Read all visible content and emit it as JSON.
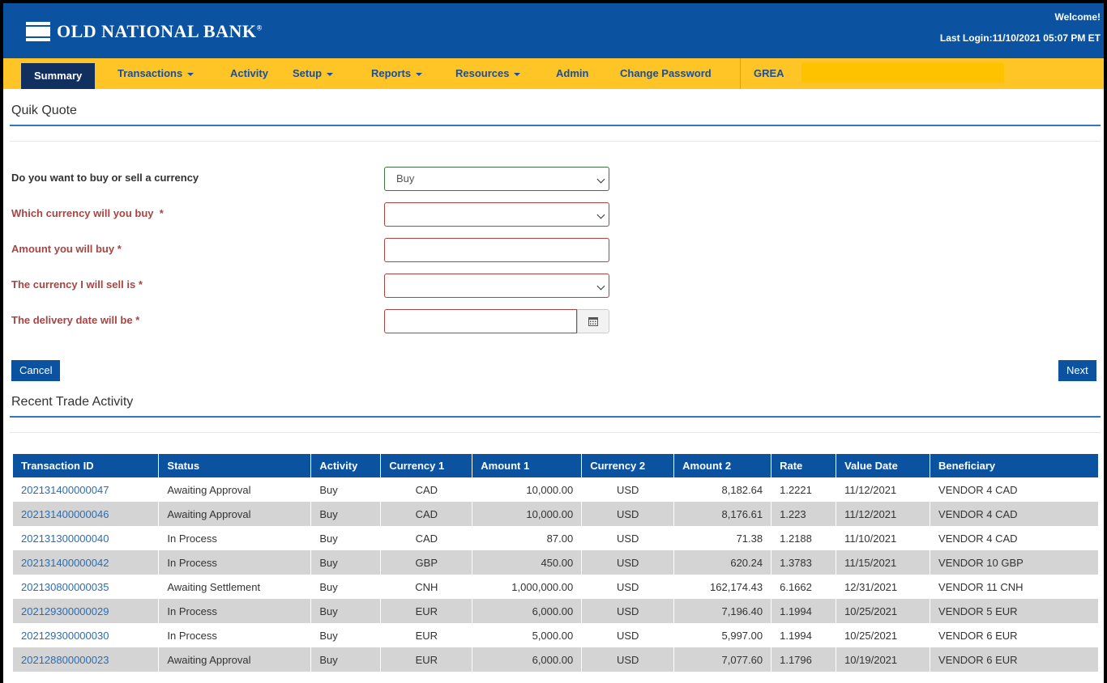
{
  "header": {
    "bank_name": "OLD NATIONAL BANK",
    "trademark": "®",
    "welcome": "Welcome!",
    "last_login": "Last Login:11/10/2021 05:07 PM ET"
  },
  "nav": {
    "items": [
      {
        "label": "Summary",
        "active": true
      },
      {
        "label": "Transactions"
      },
      {
        "label": "Activity"
      },
      {
        "label": "Setup"
      },
      {
        "label": "Reports"
      },
      {
        "label": "Resources"
      },
      {
        "label": "Admin"
      },
      {
        "label": "Change Password"
      },
      {
        "label": "GREA"
      }
    ]
  },
  "quote": {
    "title": "Quik Quote",
    "buy_sell_label": "Do you want to buy or sell a currency",
    "buy_sell_value": "Buy",
    "buy_currency_label": "Which currency will you buy",
    "amount_label": "Amount you will buy",
    "sell_currency_label": "The currency I will sell is",
    "delivery_label": "The delivery date will be",
    "required_mark": "*",
    "cancel_label": "Cancel",
    "next_label": "Next"
  },
  "activity": {
    "title": "Recent Trade Activity",
    "columns": [
      "Transaction ID",
      "Status",
      "Activity",
      "Currency 1",
      "Amount 1",
      "Currency 2",
      "Amount 2",
      "Rate",
      "Value Date",
      "Beneficiary"
    ],
    "rows": [
      [
        "202131400000047",
        "Awaiting Approval",
        "Buy",
        "CAD",
        "10,000.00",
        "USD",
        "8,182.64",
        "1.2221",
        "11/12/2021",
        "VENDOR 4 CAD"
      ],
      [
        "202131400000046",
        "Awaiting Approval",
        "Buy",
        "CAD",
        "10,000.00",
        "USD",
        "8,176.61",
        "1.223",
        "11/12/2021",
        "VENDOR 4 CAD"
      ],
      [
        "202131300000040",
        "In Process",
        "Buy",
        "CAD",
        "87.00",
        "USD",
        "71.38",
        "1.2188",
        "11/10/2021",
        "VENDOR 4 CAD"
      ],
      [
        "202131400000042",
        "In Process",
        "Buy",
        "GBP",
        "450.00",
        "USD",
        "620.24",
        "1.3783",
        "11/15/2021",
        "VENDOR 10 GBP"
      ],
      [
        "202130800000035",
        "Awaiting Settlement",
        "Buy",
        "CNH",
        "1,000,000.00",
        "USD",
        "162,174.43",
        "6.1662",
        "12/31/2021",
        "VENDOR 11 CNH"
      ],
      [
        "202129300000029",
        "In Process",
        "Buy",
        "EUR",
        "6,000.00",
        "USD",
        "7,196.40",
        "1.1994",
        "10/25/2021",
        "VENDOR 5 EUR"
      ],
      [
        "202129300000030",
        "In Process",
        "Buy",
        "EUR",
        "5,000.00",
        "USD",
        "5,997.00",
        "1.1994",
        "10/25/2021",
        "VENDOR 6 EUR"
      ],
      [
        "202128800000023",
        "Awaiting Approval",
        "Buy",
        "EUR",
        "6,000.00",
        "USD",
        "7,077.60",
        "1.1796",
        "10/19/2021",
        "VENDOR 6 EUR"
      ]
    ]
  },
  "icons": {
    "calendar": "calendar-icon",
    "dropdown": "chevron-down-icon",
    "menu_caret": "caret-down-icon"
  },
  "colors": {
    "brand_blue": "#0b52a0",
    "nav_yellow": "#ffc425",
    "nav_active": "#12305f",
    "required_red": "#a94442",
    "valid_green": "#3c763d",
    "row_alt": "#d4d4d4",
    "link_blue": "#2a6db5"
  }
}
